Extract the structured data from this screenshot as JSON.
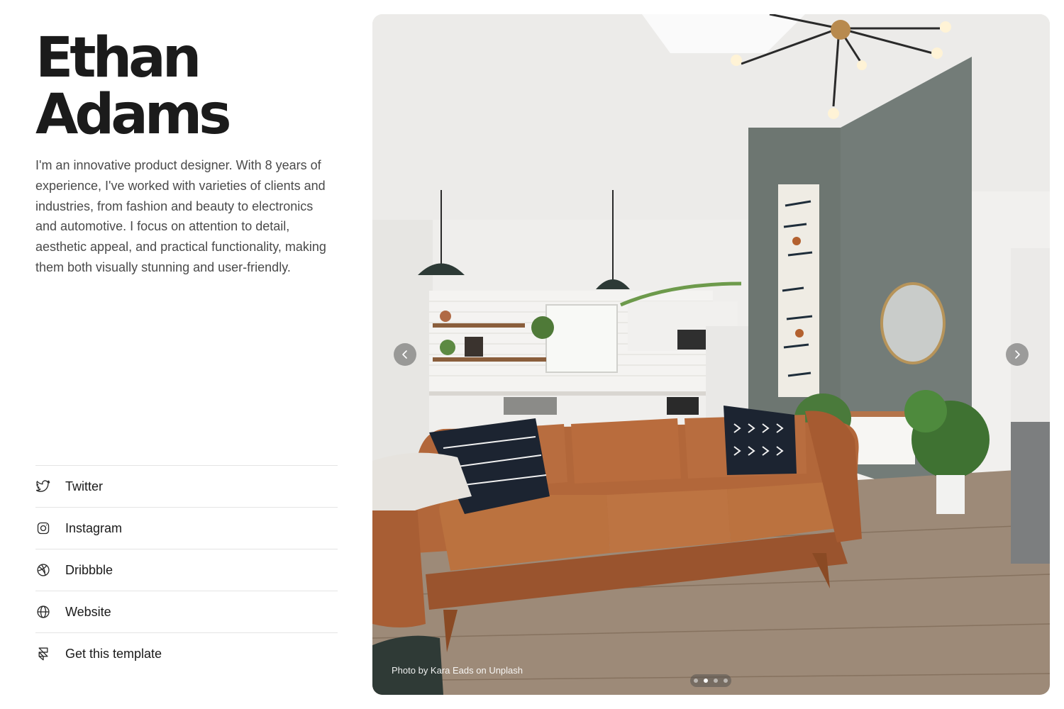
{
  "profile": {
    "first_name": "Ethan",
    "last_name": "Adams",
    "bio": "I'm an innovative product designer. With 8 years of experience, I've worked with varieties of clients and industries, from fashion and beauty to electronics and automotive. I focus on attention to detail, aesthetic appeal, and practical functionality, making them both visually stunning and user-friendly."
  },
  "links": [
    {
      "label": "Twitter",
      "icon": "twitter-icon"
    },
    {
      "label": "Instagram",
      "icon": "instagram-icon"
    },
    {
      "label": "Dribbble",
      "icon": "dribbble-icon"
    },
    {
      "label": "Website",
      "icon": "globe-icon"
    },
    {
      "label": "Get this template",
      "icon": "framer-icon"
    }
  ],
  "gallery": {
    "credit": "Photo by Kara Eads on Unplash",
    "slides_count": 4,
    "active_slide": 2,
    "prev_icon": "chevron-left-icon",
    "next_icon": "chevron-right-icon",
    "image": "living-room-photo"
  },
  "colors": {
    "heading": "#1b1b1b",
    "body_text": "#4a4a4a",
    "divider": "#e4e4e4"
  }
}
